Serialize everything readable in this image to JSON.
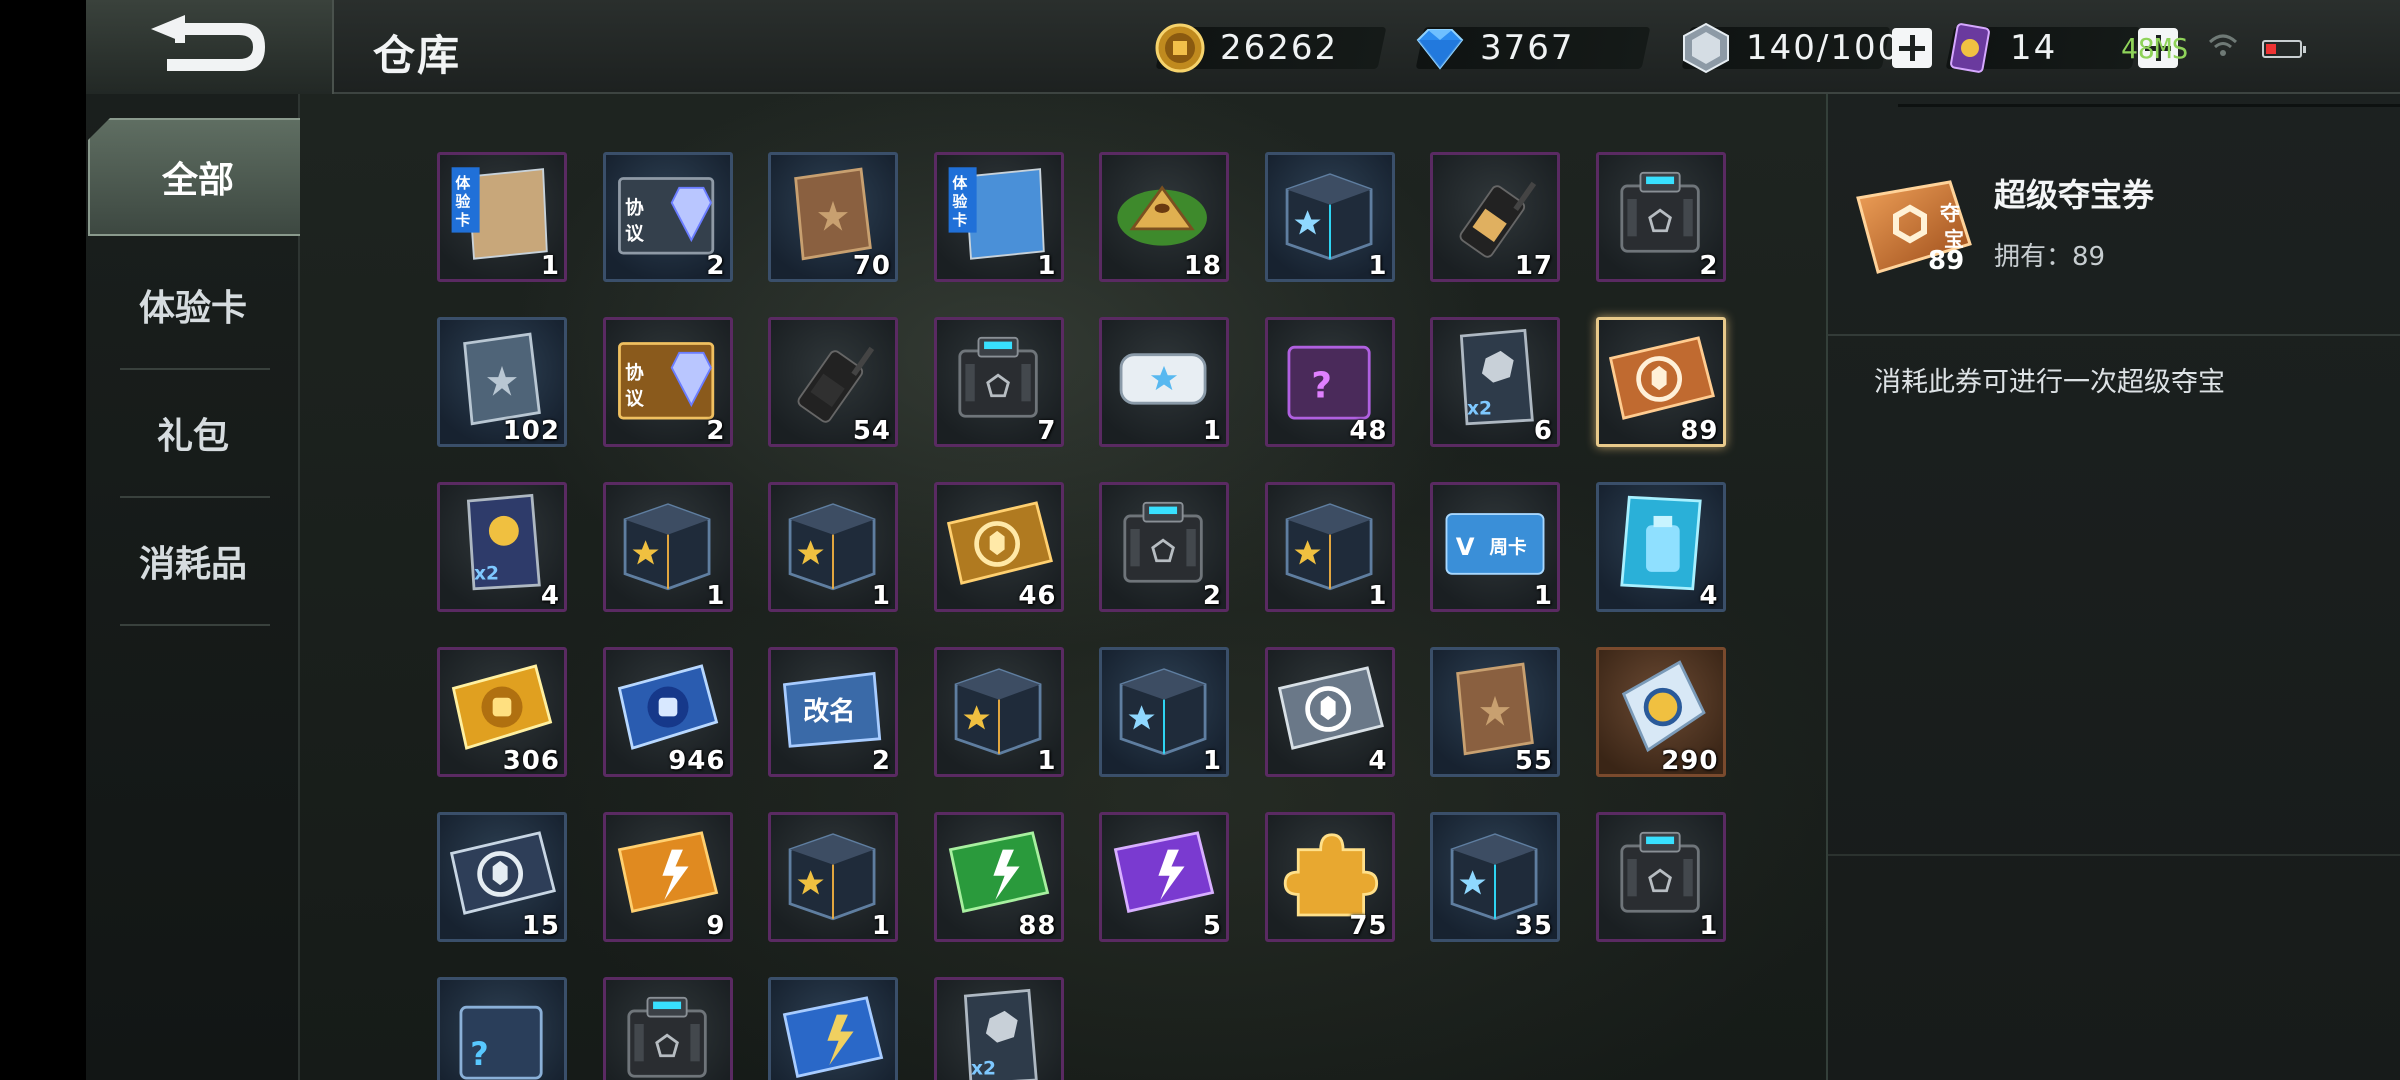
{
  "header": {
    "title": "仓库",
    "resources": [
      {
        "name": "gold",
        "icon": "gold-coin-icon",
        "value": "26262"
      },
      {
        "name": "diamond",
        "icon": "diamond-icon",
        "value": "3767"
      },
      {
        "name": "energy",
        "icon": "energy-crystal-icon",
        "value": "140/100"
      },
      {
        "name": "card",
        "icon": "purple-card-icon",
        "value": "14"
      }
    ],
    "ping": "48MS"
  },
  "sidebar": {
    "items": [
      {
        "label": "全部",
        "active": true
      },
      {
        "label": "体验卡",
        "active": false
      },
      {
        "label": "礼包",
        "active": false
      },
      {
        "label": "消耗品",
        "active": false
      }
    ]
  },
  "inventory": {
    "items": [
      {
        "icon": "experience-card-ship-icon",
        "count": "1"
      },
      {
        "icon": "protocol-diamond-silver-icon",
        "count": "2"
      },
      {
        "icon": "brown-book-star-icon",
        "count": "70"
      },
      {
        "icon": "experience-card-tank-icon",
        "count": "1"
      },
      {
        "icon": "zongzi-dumpling-icon",
        "count": "18"
      },
      {
        "icon": "blue-star-crate-icon",
        "count": "1"
      },
      {
        "icon": "walkie-talkie-gold-icon",
        "count": "17"
      },
      {
        "icon": "dark-supply-crate-icon",
        "count": "2"
      },
      {
        "icon": "steel-book-star-icon",
        "count": "102"
      },
      {
        "icon": "protocol-diamond-gold-icon",
        "count": "2"
      },
      {
        "icon": "walkie-talkie-black-icon",
        "count": "54"
      },
      {
        "icon": "dark-supply-crate-icon",
        "count": "7"
      },
      {
        "icon": "white-star-capsule-icon",
        "count": "1"
      },
      {
        "icon": "purple-mystery-crate-icon",
        "count": "48"
      },
      {
        "icon": "double-coupon-silver-icon",
        "count": "6"
      },
      {
        "icon": "super-treasure-ticket-icon",
        "count": "89"
      },
      {
        "icon": "double-coupon-gold-icon",
        "count": "4"
      },
      {
        "icon": "gold-star-crate-icon",
        "count": "1"
      },
      {
        "icon": "gold-star-crate-icon",
        "count": "1"
      },
      {
        "icon": "appointment-gold-ticket-icon",
        "count": "46"
      },
      {
        "icon": "dark-supply-crate-icon",
        "count": "2"
      },
      {
        "icon": "gold-star-crate-icon",
        "count": "1"
      },
      {
        "icon": "weekly-card-icon",
        "count": "1"
      },
      {
        "icon": "blue-potion-card-icon",
        "count": "4"
      },
      {
        "icon": "gold-fist-ticket-icon",
        "count": "306"
      },
      {
        "icon": "blue-fist-ticket-icon",
        "count": "946"
      },
      {
        "icon": "rename-card-icon",
        "count": "2"
      },
      {
        "icon": "gold-star-crate-icon",
        "count": "1"
      },
      {
        "icon": "blue-star-crate-icon",
        "count": "1"
      },
      {
        "icon": "treasure-ticket-silver-icon",
        "count": "4"
      },
      {
        "icon": "brown-book-star-icon",
        "count": "55"
      },
      {
        "icon": "blue-gear-ticket-icon",
        "count": "290"
      },
      {
        "icon": "appointment-silver-ticket-icon",
        "count": "15"
      },
      {
        "icon": "orange-lightning-card-icon",
        "count": "9"
      },
      {
        "icon": "gold-star-crate-icon",
        "count": "1"
      },
      {
        "icon": "green-lightning-card-icon",
        "count": "88"
      },
      {
        "icon": "purple-lightning-card-icon",
        "count": "5"
      },
      {
        "icon": "gold-puzzle-piece-icon",
        "count": "75"
      },
      {
        "icon": "blue-star-crate-icon",
        "count": "35"
      },
      {
        "icon": "dark-supply-crate-icon",
        "count": "1"
      },
      {
        "icon": "mystery-blue-crate-icon",
        "count": ""
      },
      {
        "icon": "dark-supply-crate-icon",
        "count": ""
      },
      {
        "icon": "blue-lightning-card-icon",
        "count": ""
      },
      {
        "icon": "double-coupon-silver-icon",
        "count": ""
      }
    ],
    "selected_index": 15
  },
  "detail": {
    "name": "超级夺宝券",
    "icon": "super-treasure-ticket-icon",
    "icon_count": "89",
    "owned": "拥有：89",
    "description": "消耗此券可进行一次超级夺宝"
  }
}
